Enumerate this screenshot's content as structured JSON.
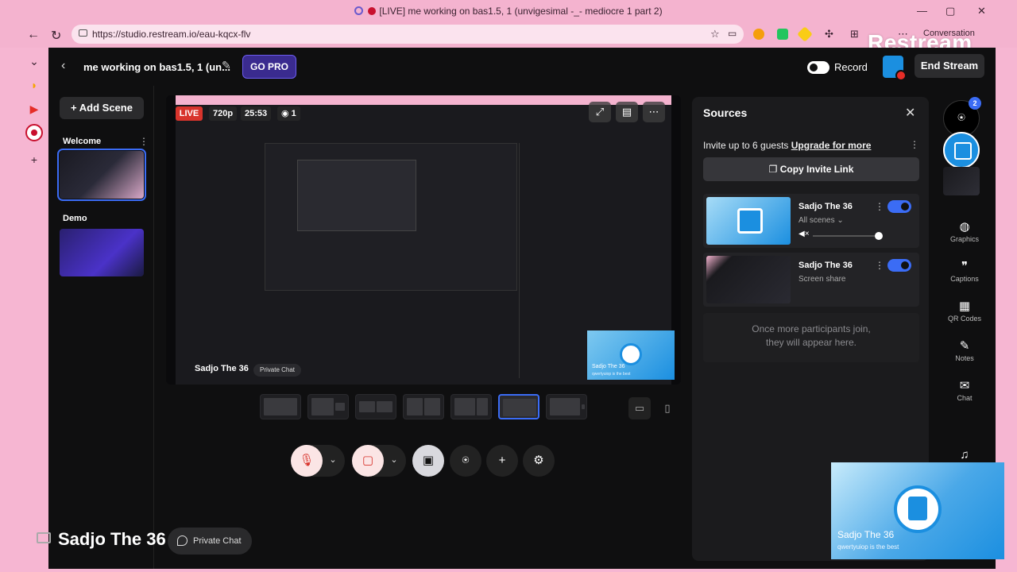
{
  "browser": {
    "tab_title": "[LIVE] me working on bas1.5, 1 (unvigesimal -_- mediocre 1 part 2)",
    "url": "https://studio.restream.io/eau-kqcx-flv",
    "conversation_label": "Conversation",
    "brand_overlay": "Restream"
  },
  "header": {
    "stream_title": "me working on bas1.5, 1 (un...",
    "go_pro": "GO PRO",
    "record_label": "Record",
    "end_stream": "End Stream"
  },
  "scenes": {
    "add_scene": "+ Add Scene",
    "items": [
      {
        "label": "Welcome",
        "active": true
      },
      {
        "label": "Demo",
        "active": false
      }
    ]
  },
  "preview": {
    "live": "LIVE",
    "resolution": "720p",
    "timer": "25:53",
    "viewers": "1",
    "participant_name": "Sadjo The 36",
    "private_chat": "Private Chat",
    "cam_name": "Sadjo The 36",
    "cam_sub": "qwertyuiop is the best"
  },
  "sources": {
    "title": "Sources",
    "invite_text": "Invite up to 6 guests",
    "upgrade": "Upgrade for more",
    "copy_invite": "Copy Invite Link",
    "items": [
      {
        "name": "Sadjo The 36",
        "sub": "All scenes ⌄",
        "kind": "camera"
      },
      {
        "name": "Sadjo The 36",
        "sub": "Screen share",
        "kind": "screen"
      }
    ],
    "empty_line1": "Once more participants join,",
    "empty_line2": "they will appear here."
  },
  "rail": {
    "guest_count": "2",
    "tools": [
      {
        "label": "Graphics",
        "icon": "palette-icon"
      },
      {
        "label": "Captions",
        "icon": "quote-icon"
      },
      {
        "label": "QR Codes",
        "icon": "qr-icon"
      },
      {
        "label": "Notes",
        "icon": "notes-icon"
      },
      {
        "label": "Chat",
        "icon": "chat-icon"
      }
    ]
  },
  "overlay": {
    "name": "Sadjo The 36",
    "private_chat": "Private Chat",
    "cam_name": "Sadjo The 36",
    "cam_sub": "qwertyuiop is the best"
  },
  "colors": {
    "accent": "#3b6cf5",
    "live": "#d8342c",
    "pink_bg": "#f6b6d2",
    "app_bg": "#0f0f10"
  }
}
